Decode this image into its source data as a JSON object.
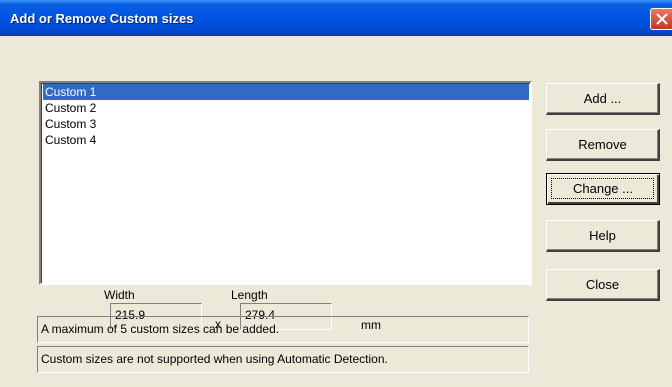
{
  "window": {
    "title": "Add or Remove Custom sizes",
    "close_glyph": "✕"
  },
  "custom_sizes": {
    "items": [
      {
        "label": "Custom 1",
        "selected": true
      },
      {
        "label": "Custom 2",
        "selected": false
      },
      {
        "label": "Custom 3",
        "selected": false
      },
      {
        "label": "Custom 4",
        "selected": false
      }
    ]
  },
  "buttons": {
    "add": "Add ...",
    "remove": "Remove",
    "change": "Change ...",
    "help": "Help",
    "close": "Close"
  },
  "dimensions": {
    "width_label": "Width",
    "width_value": "215.9",
    "times_sign": "x",
    "length_label": "Length",
    "length_value": "279.4",
    "unit": "mm"
  },
  "messages": {
    "max_notice": "A maximum of 5 custom sizes can be added.",
    "auto_detect_notice": "Custom sizes are not supported when using Automatic Detection."
  },
  "colors": {
    "title_bar": "#0054e3",
    "selection": "#316ac5",
    "face": "#ece9d8",
    "close_button": "#c1352a"
  }
}
